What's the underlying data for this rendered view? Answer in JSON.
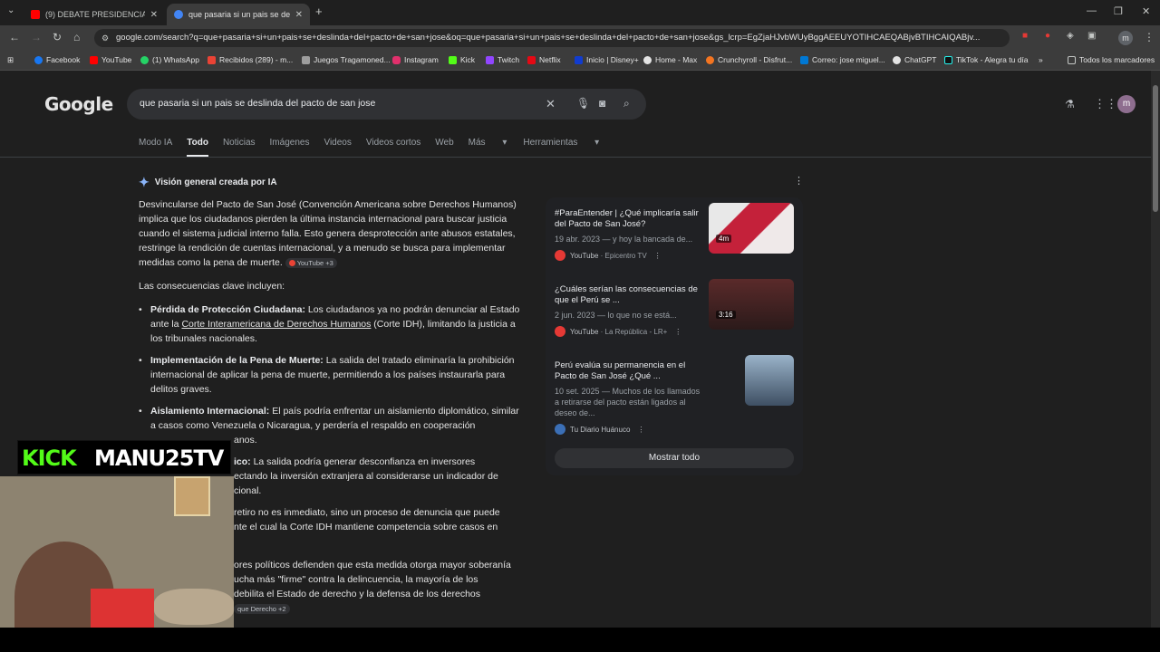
{
  "browser": {
    "tabs": [
      {
        "title": "(9) DEBATE PRESIDENCIAL DEL",
        "favicon_color": "#ff0000"
      },
      {
        "title": "que pasaria si un pais se deslinc",
        "favicon_color": "#4285f4"
      }
    ],
    "new_tab_label": "+",
    "url": "google.com/search?q=que+pasaria+si+un+pais+se+deslinda+del+pacto+de+san+jose&oq=que+pasaria+si+un+pais+se+deslinda+del+pacto+de+san+jose&gs_lcrp=EgZjaHJvbWUyBggAEEUYOTIHCAEQABjvBTIHCAIQABjv...",
    "profile_initial": "m",
    "bookmarks": [
      "Facebook",
      "YouTube",
      "(1) WhatsApp",
      "Recibidos (289) - m...",
      "Juegos Tragamoned...",
      "Instagram",
      "Kick",
      "Twitch",
      "Netflix",
      "Inicio | Disney+",
      "Home - Max",
      "Crunchyroll - Disfrut...",
      "Correo: jose miguel...",
      "ChatGPT",
      "TikTok - Alegra tu día"
    ],
    "all_bookmarks": "Todos los marcadores"
  },
  "google": {
    "logo": "Google",
    "query": "que pasaria si un pais se deslinda del pacto de san jose",
    "tabs": [
      "Modo IA",
      "Todo",
      "Noticias",
      "Imágenes",
      "Videos",
      "Videos cortos",
      "Web",
      "Más",
      "Herramientas"
    ],
    "active_tab": "Todo",
    "profile_initial": "m"
  },
  "ai_overview": {
    "heading": "Visión general creada por IA",
    "intro": "Desvincularse del Pacto de San José (Convención Americana sobre Derechos Humanos) implica que los ciudadanos pierden la última instancia internacional para buscar justicia cuando el sistema judicial interno falla. Esto genera desprotección ante abusos estatales, restringe la rendición de cuentas internacional, y a menudo se busca para implementar medidas como la pena de muerte.",
    "intro_chip": "YouTube +3",
    "consequences_label": "Las consecuencias clave incluyen:",
    "items": [
      {
        "title": "Pérdida de Protección Ciudadana:",
        "pre": " Los ciudadanos ya no podrán denunciar al Estado ante la ",
        "link": "Corte Interamericana de Derechos Humanos",
        "post": " (Corte IDH), limitando la justicia a los tribunales nacionales."
      },
      {
        "title": "Implementación de la Pena de Muerte:",
        "text": " La salida del tratado eliminaría la prohibición internacional de aplicar la pena de muerte, permitiendo a los países instaurarla para delitos graves."
      },
      {
        "title": "Aislamiento Internacional:",
        "text": " El país podría enfrentar un aislamiento diplomático, similar a casos como Venezuela o Nicaragua, y perdería el respaldo en cooperación"
      },
      {
        "text": "anos."
      },
      {
        "title": "ico:",
        "text": " La salida podría generar desconfianza en inversores"
      },
      {
        "text": "ectando la inversión extranjera al considerarse un indicador de"
      },
      {
        "text": "cional."
      },
      {
        "text": "retiro no es inmediato, sino un proceso de denuncia que puede"
      },
      {
        "text": "nte el cual la Corte IDH mantiene competencia sobre casos en"
      },
      {
        "text": "ores políticos defienden que esta medida otorga mayor soberanía"
      },
      {
        "text": "ucha más \"firme\" contra la delincuencia, la mayoría de los"
      },
      {
        "text": "debilita el Estado de derecho y la defensa de los derechos"
      }
    ],
    "end_chip": "que Derecho +2"
  },
  "sources": [
    {
      "title": "#ParaEntender | ¿Qué implicaría salir del Pacto de San José?",
      "snippet": "19 abr. 2023 — y hoy la bancada de...",
      "source": "YouTube",
      "channel": "· Epicentro TV",
      "duration": "4m"
    },
    {
      "title": "¿Cuáles serían las consecuencias de que el Perú se ...",
      "snippet": "2 jun. 2023 — lo que no se está...",
      "source": "YouTube",
      "channel": "· La República - LR+",
      "duration": "3:16"
    },
    {
      "title": "Perú evalúa su permanencia en el Pacto de San José ¿Qué ...",
      "snippet": "10 set. 2025 — Muchos de los llamados a retirarse del pacto están ligados al deseo de...",
      "source": "Tu Diario Huánuco",
      "channel": ""
    }
  ],
  "show_all": "Mostrar todo",
  "overlay": {
    "kick": "KICK",
    "name": "MANU25TV"
  }
}
